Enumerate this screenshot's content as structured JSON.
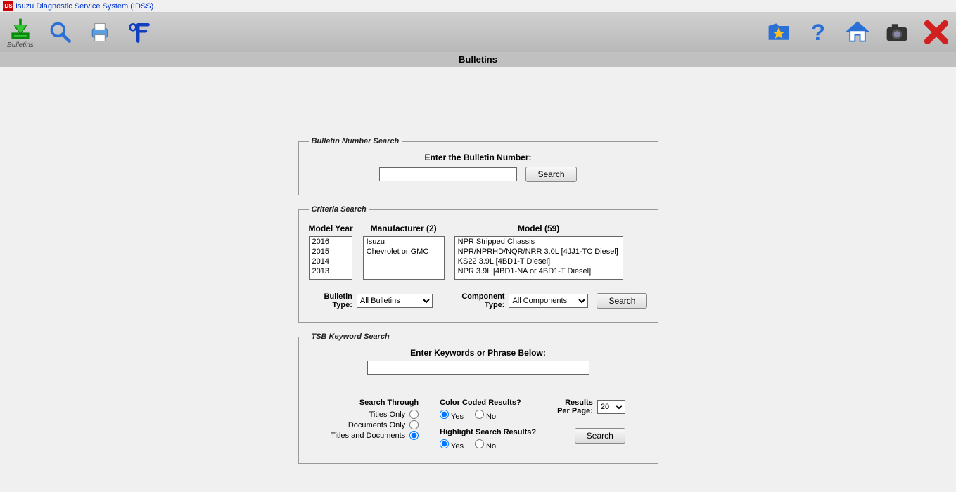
{
  "window": {
    "title": "Isuzu Diagnostic Service System (IDSS)"
  },
  "toolbar": {
    "bulletins_label": "Bulletins"
  },
  "page_title": "Bulletins",
  "bulletin_number_search": {
    "legend": "Bulletin Number Search",
    "label": "Enter the Bulletin Number:",
    "value": "",
    "search_btn": "Search"
  },
  "criteria_search": {
    "legend": "Criteria Search",
    "model_year": {
      "header": "Model Year",
      "items": [
        "2016",
        "2015",
        "2014",
        "2013"
      ]
    },
    "manufacturer": {
      "header": "Manufacturer (2)",
      "items": [
        "Isuzu",
        "Chevrolet or GMC"
      ]
    },
    "model": {
      "header": "Model (59)",
      "items": [
        "NPR Stripped Chassis",
        "NPR/NPRHD/NQR/NRR 3.0L [4JJ1-TC Diesel]",
        "KS22 3.9L [4BD1-T Diesel]",
        "NPR 3.9L [4BD1-NA or 4BD1-T Diesel]"
      ]
    },
    "bulletin_type": {
      "label": "Bulletin Type:",
      "selected": "All Bulletins"
    },
    "component_type": {
      "label": "Component Type:",
      "selected": "All Components"
    },
    "search_btn": "Search"
  },
  "tsb_keyword_search": {
    "legend": "TSB Keyword Search",
    "label": "Enter Keywords or Phrase Below:",
    "value": "",
    "search_through": {
      "header": "Search Through",
      "titles_only": "Titles Only",
      "documents_only": "Documents Only",
      "titles_and_documents": "Titles and Documents"
    },
    "color_coded": {
      "header": "Color Coded Results?",
      "yes": "Yes",
      "no": "No"
    },
    "highlight": {
      "header": "Highlight Search Results?",
      "yes": "Yes",
      "no": "No"
    },
    "results_per_page": {
      "label_line1": "Results",
      "label_line2": "Per Page:",
      "value": "20"
    },
    "search_btn": "Search"
  }
}
